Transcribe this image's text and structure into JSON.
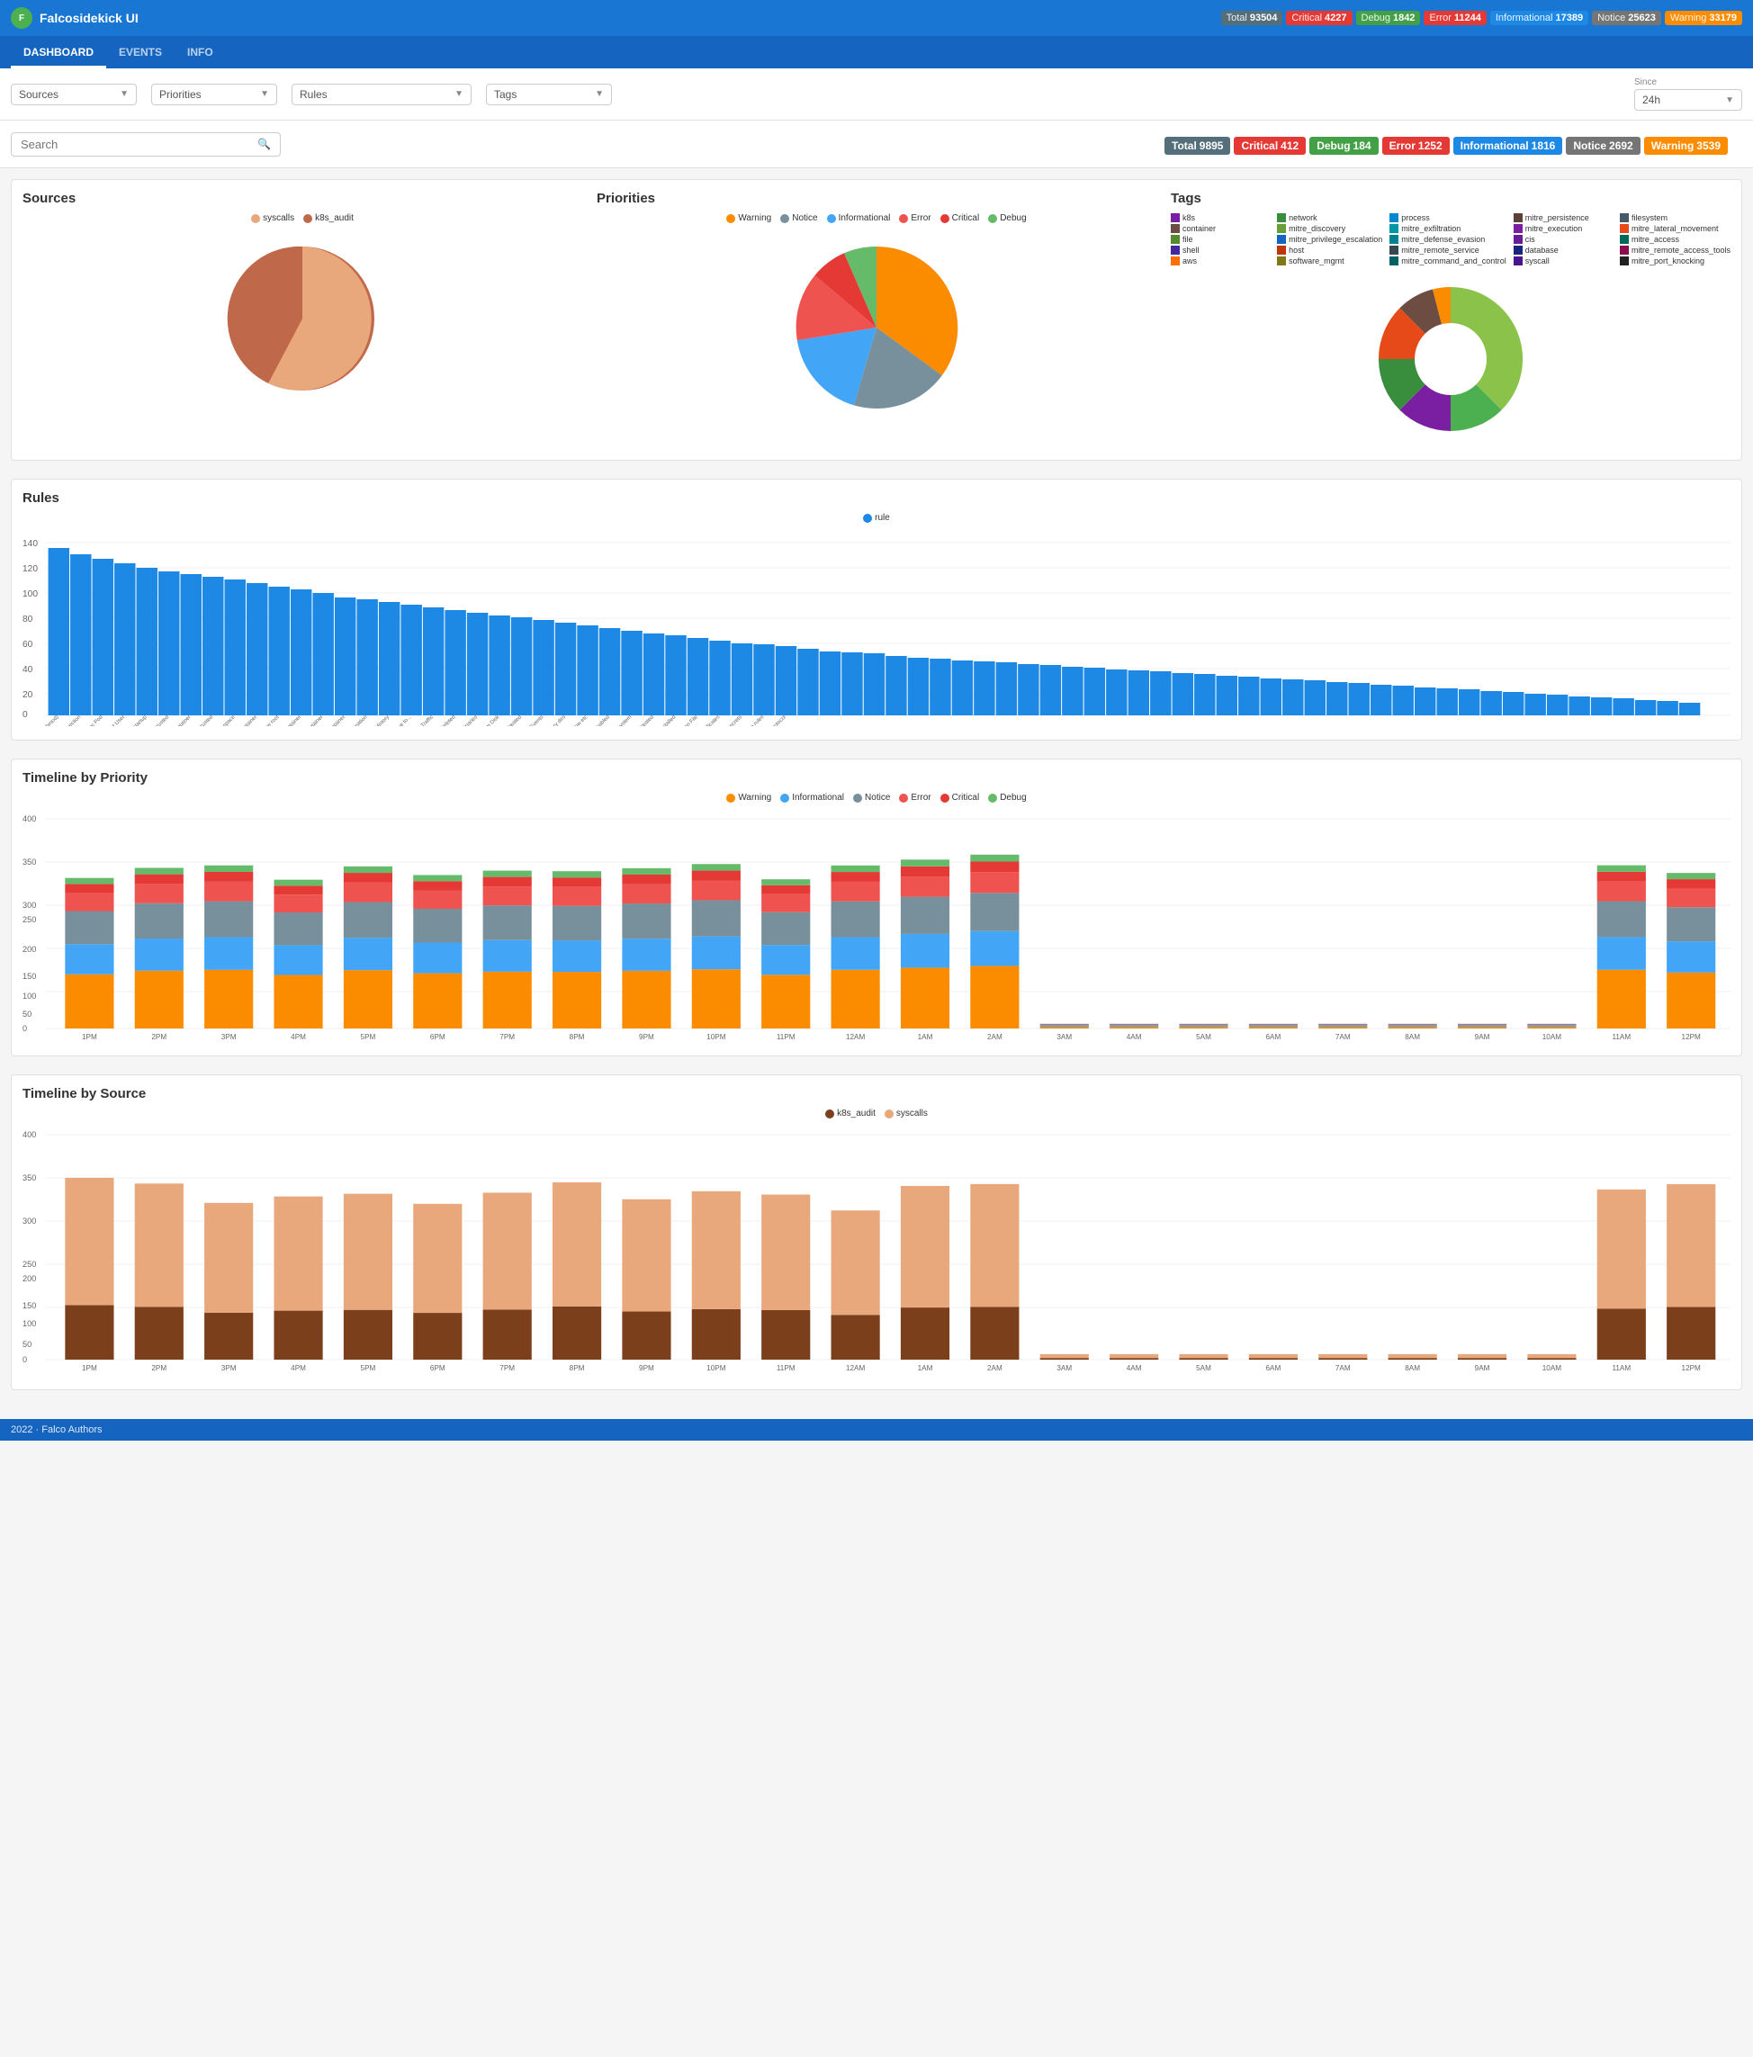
{
  "navbar": {
    "brand": "Falcosidekick UI",
    "stats": [
      {
        "label": "Total",
        "value": "93504",
        "class": "badge-total"
      },
      {
        "label": "Critical",
        "value": "4227",
        "class": "badge-critical"
      },
      {
        "label": "Debug",
        "value": "1842",
        "class": "badge-debug"
      },
      {
        "label": "Error",
        "value": "11244",
        "class": "badge-error"
      },
      {
        "label": "Informational",
        "value": "17389",
        "class": "badge-informational"
      },
      {
        "label": "Notice",
        "value": "25623",
        "class": "badge-notice"
      },
      {
        "label": "Warning",
        "value": "33179",
        "class": "badge-warning"
      }
    ]
  },
  "tabs": [
    {
      "label": "DASHBOARD",
      "active": true
    },
    {
      "label": "EVENTS",
      "active": false
    },
    {
      "label": "INFO",
      "active": false
    }
  ],
  "filters": {
    "sources_label": "Sources",
    "priorities_label": "Priorities",
    "rules_label": "Rules",
    "tags_label": "Tags",
    "since_label": "Since",
    "since_value": "24h"
  },
  "search": {
    "placeholder": "Search"
  },
  "summary": {
    "total": {
      "label": "Total",
      "value": "9895"
    },
    "critical": {
      "label": "Critical",
      "value": "412"
    },
    "debug": {
      "label": "Debug",
      "value": "184"
    },
    "error": {
      "label": "Error",
      "value": "1252"
    },
    "informational": {
      "label": "Informational",
      "value": "1816"
    },
    "notice": {
      "label": "Notice",
      "value": "2692"
    },
    "warning": {
      "label": "Warning",
      "value": "3539"
    }
  },
  "sections": {
    "sources": "Sources",
    "priorities": "Priorities",
    "tags": "Tags",
    "rules": "Rules",
    "timeline_priority": "Timeline by Priority",
    "timeline_source": "Timeline by Source"
  },
  "sources_legend": [
    {
      "label": "syscalls",
      "color": "#e8a87c"
    },
    {
      "label": "k8s_audit",
      "color": "#c0694a"
    }
  ],
  "priorities_legend": [
    {
      "label": "Warning",
      "color": "#fb8c00"
    },
    {
      "label": "Notice",
      "color": "#78909c"
    },
    {
      "label": "Informational",
      "color": "#42a5f5"
    },
    {
      "label": "Error",
      "color": "#ef5350"
    },
    {
      "label": "Critical",
      "color": "#e53935"
    },
    {
      "label": "Debug",
      "color": "#66bb6a"
    }
  ],
  "tags_legend": [
    {
      "label": "k8s",
      "color": "#7b1fa2"
    },
    {
      "label": "network",
      "color": "#388e3c"
    },
    {
      "label": "process",
      "color": "#0288d1"
    },
    {
      "label": "mitre_persistence",
      "color": "#5d4037"
    },
    {
      "label": "filesystem",
      "color": "#455a64"
    },
    {
      "label": "container",
      "color": "#6d4c41"
    },
    {
      "label": "mitre_discovery",
      "color": "#689f38"
    },
    {
      "label": "mitre_exfiltration",
      "color": "#0097a7"
    },
    {
      "label": "mitre_execution",
      "color": "#7b1fa2"
    },
    {
      "label": "mitre_lateral_movement",
      "color": "#e64a19"
    },
    {
      "label": "file",
      "color": "#558b2f"
    },
    {
      "label": "mitre_privilege_escalation",
      "color": "#1565c0"
    },
    {
      "label": "mitre_defense_evasion",
      "color": "#00838f"
    },
    {
      "label": "cis",
      "color": "#6a1b9a"
    },
    {
      "label": "mitre_access",
      "color": "#00695c"
    },
    {
      "label": "shell",
      "color": "#4527a0"
    },
    {
      "label": "process",
      "color": "#2e7d32"
    },
    {
      "label": "host",
      "color": "#bf360c"
    },
    {
      "label": "mitre_remote_service",
      "color": "#37474f"
    },
    {
      "label": "database",
      "color": "#1a237e"
    },
    {
      "label": "mitre_remote_access_tools",
      "color": "#880e4f"
    },
    {
      "label": "aws",
      "color": "#ff6f00"
    },
    {
      "label": "software_mgmt",
      "color": "#827717"
    },
    {
      "label": "mitre_command_and_control",
      "color": "#006064"
    },
    {
      "label": "syscall",
      "color": "#4a148c"
    },
    {
      "label": "mitre_port_knocking",
      "color": "#212121"
    }
  ],
  "timeline_priority_legend": [
    {
      "label": "Warning",
      "color": "#fb8c00"
    },
    {
      "label": "Informational",
      "color": "#42a5f5"
    },
    {
      "label": "Notice",
      "color": "#78909c"
    },
    {
      "label": "Error",
      "color": "#ef5350"
    },
    {
      "label": "Critical",
      "color": "#e53935"
    },
    {
      "label": "Debug",
      "color": "#66bb6a"
    }
  ],
  "timeline_source_legend": [
    {
      "label": "k8s_audit",
      "color": "#7b3f1c"
    },
    {
      "label": "syscalls",
      "color": "#e8a87c"
    }
  ],
  "timeline_labels": [
    "1PM",
    "2PM",
    "3PM",
    "4PM",
    "5PM",
    "6PM",
    "7PM",
    "8PM",
    "9PM",
    "10PM",
    "11PM",
    "12AM",
    "1AM",
    "2AM",
    "3AM",
    "4AM",
    "5AM",
    "6AM",
    "7AM",
    "8AM",
    "9AM",
    "10AM",
    "11AM",
    "12PM"
  ],
  "footer": "2022 · Falco Authors"
}
